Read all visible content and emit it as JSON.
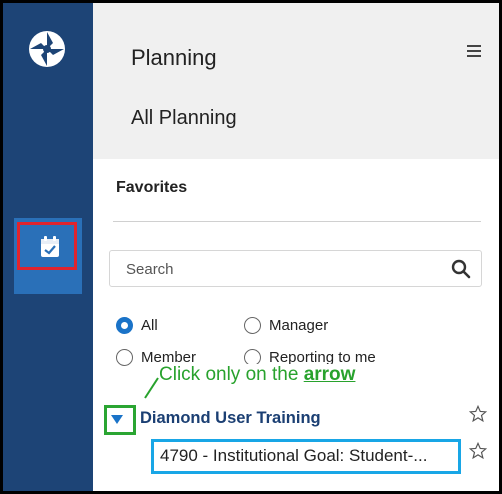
{
  "app": {
    "brand_color": "#1d4476",
    "accent": "#1a73c8"
  },
  "rail": {
    "logo_icon": "diamond-logo-icon",
    "active_item": {
      "icon": "calendar-check-icon",
      "highlight_color": "#e0242d"
    }
  },
  "header": {
    "title": "Planning",
    "subtitle": "All Planning",
    "menu_icon": "hamburger-menu-icon"
  },
  "favorites": {
    "label": "Favorites"
  },
  "search": {
    "placeholder": "Search",
    "value": "",
    "icon": "search-icon"
  },
  "filters": {
    "options": [
      {
        "label": "All",
        "selected": true
      },
      {
        "label": "Manager",
        "selected": false
      },
      {
        "label": "Member",
        "selected": false
      },
      {
        "label": "Reporting to me",
        "selected": false
      }
    ]
  },
  "annotation": {
    "text_prefix": "Click only on the",
    "text_emphasis": "arrow",
    "color": "#28a22d"
  },
  "tree": {
    "group": {
      "label": "Diamond User Training",
      "expanded": true,
      "star_icon": "star-outline-icon"
    },
    "children": [
      {
        "label": "4790 - Institutional Goal: Student-...",
        "star_icon": "star-outline-icon"
      }
    ]
  }
}
